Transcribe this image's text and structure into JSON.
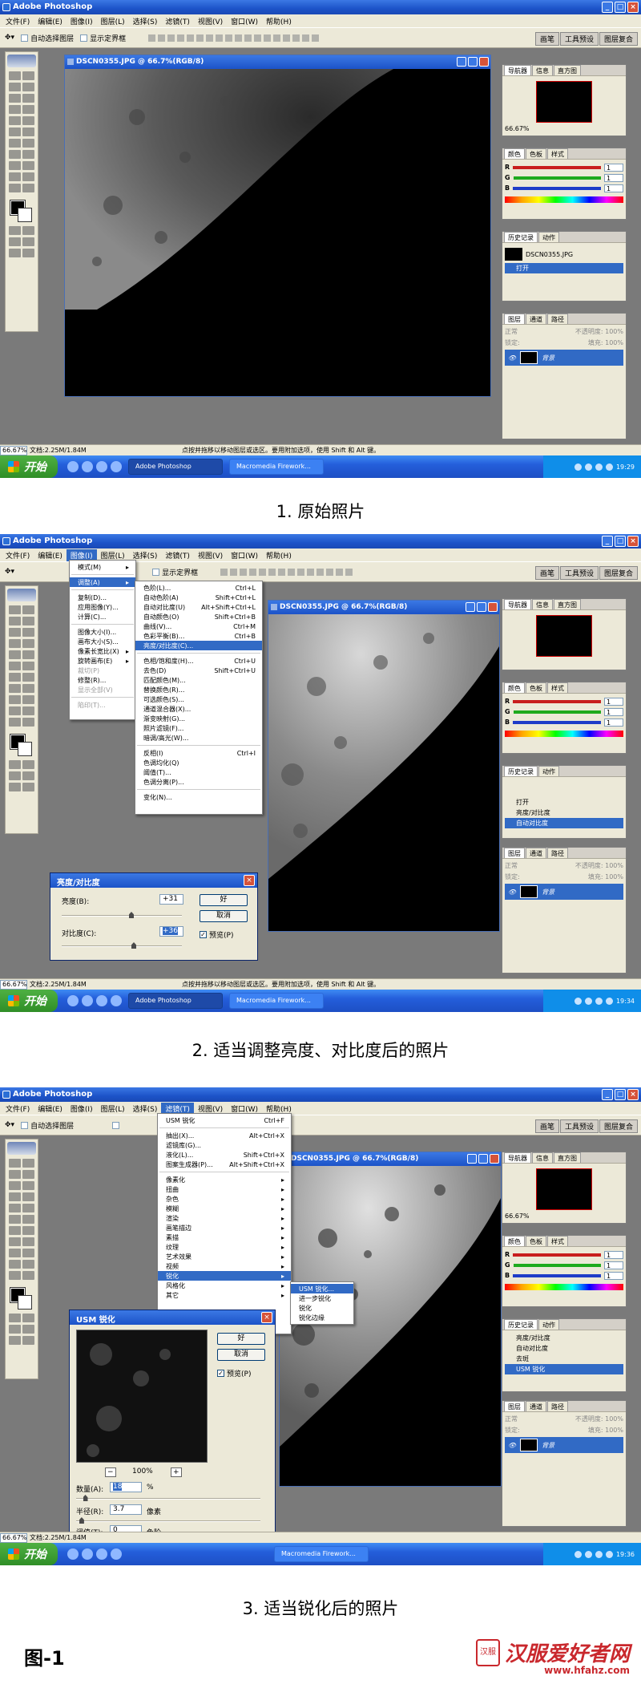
{
  "app": {
    "title": "Adobe Photoshop",
    "menus": [
      "文件(F)",
      "编辑(E)",
      "图像(I)",
      "图层(L)",
      "选择(S)",
      "滤镜(T)",
      "视图(V)",
      "窗口(W)",
      "帮助(H)"
    ],
    "opt_auto_select": "自动选择图层",
    "opt_show_bounds": "显示定界框",
    "palette_well": [
      "画笔",
      "工具预设",
      "图层复合"
    ]
  },
  "panels": {
    "navigator_tabs": [
      "导航器",
      "信息",
      "直方图"
    ],
    "navigator_zoom": "66.67%",
    "color_tabs": [
      "颜色",
      "色板",
      "样式"
    ],
    "color_rows": [
      {
        "label": "R",
        "value": "1",
        "color": "#c81e1e"
      },
      {
        "label": "G",
        "value": "1",
        "color": "#1eaa1e"
      },
      {
        "label": "B",
        "value": "1",
        "color": "#1e3cc8"
      }
    ],
    "history_tabs": [
      "历史记录",
      "动作"
    ],
    "history_doc": "DSCN0355.JPG",
    "layers_tabs": [
      "图层",
      "通道",
      "路径"
    ],
    "blend_mode": "正常",
    "opacity_label": "不透明度:",
    "opacity_value": "100%",
    "lock_label": "锁定:",
    "fill_label": "填充:",
    "fill_value": "100%",
    "layer_name": "背景"
  },
  "status": {
    "zoom": "66.67%",
    "doc_info": "文档:2.25M/1.84M",
    "tip": "点按并拖移以移动图层或选区。要用附加选项，使用 Shift 和 Alt 键。"
  },
  "taskbar": {
    "start": "开始",
    "task1": "Adobe Photoshop",
    "task2": "Macromedia Firework..."
  },
  "shots": [
    {
      "doc_title": "DSCN0355.JPG @ 66.7%(RGB/8)",
      "history": [
        "打开"
      ],
      "clock": "19:29",
      "caption": "1. 原始照片"
    },
    {
      "doc_title": "DSCN0355.JPG @ 66.7%(RGB/8)",
      "history": [
        "打开",
        "亮度/对比度",
        "自动对比度"
      ],
      "clock": "19:34",
      "caption": "2. 适当调整亮度、对比度后的照片"
    },
    {
      "doc_title": "DSCN0355.JPG @ 66.7%(RGB/8)",
      "history": [
        "亮度/对比度",
        "自动对比度",
        "去斑",
        "USM 锐化"
      ],
      "clock": "19:36",
      "caption": "3. 适当锐化后的照片"
    }
  ],
  "image_menu": {
    "items": [
      {
        "label": "模式(M)",
        "arrow": true
      },
      {
        "sep": true
      },
      {
        "label": "调整(A)",
        "arrow": true,
        "sel": true
      },
      {
        "sep": true
      },
      {
        "label": "复制(D)..."
      },
      {
        "label": "应用图像(Y)..."
      },
      {
        "label": "计算(C)..."
      },
      {
        "sep": true
      },
      {
        "label": "图像大小(I)..."
      },
      {
        "label": "画布大小(S)..."
      },
      {
        "label": "像素长宽比(X)",
        "arrow": true
      },
      {
        "label": "旋转画布(E)",
        "arrow": true
      },
      {
        "label": "裁切(P)",
        "dis": true
      },
      {
        "label": "修整(R)..."
      },
      {
        "label": "显示全部(V)",
        "dis": true
      },
      {
        "sep": true
      },
      {
        "label": "陷印(T)...",
        "dis": true
      }
    ]
  },
  "adjust_menu": {
    "items": [
      {
        "label": "色阶(L)...",
        "key": "Ctrl+L"
      },
      {
        "label": "自动色阶(A)",
        "key": "Shift+Ctrl+L"
      },
      {
        "label": "自动对比度(U)",
        "key": "Alt+Shift+Ctrl+L"
      },
      {
        "label": "自动颜色(O)",
        "key": "Shift+Ctrl+B"
      },
      {
        "label": "曲线(V)...",
        "key": "Ctrl+M"
      },
      {
        "label": "色彩平衡(B)...",
        "key": "Ctrl+B"
      },
      {
        "label": "亮度/对比度(C)...",
        "sel": true
      },
      {
        "sep": true
      },
      {
        "label": "色相/饱和度(H)...",
        "key": "Ctrl+U"
      },
      {
        "label": "去色(D)",
        "key": "Shift+Ctrl+U"
      },
      {
        "label": "匹配颜色(M)..."
      },
      {
        "label": "替换颜色(R)..."
      },
      {
        "label": "可选颜色(S)..."
      },
      {
        "label": "通道混合器(X)..."
      },
      {
        "label": "渐变映射(G)..."
      },
      {
        "label": "照片滤镜(F)..."
      },
      {
        "label": "暗调/高光(W)..."
      },
      {
        "sep": true
      },
      {
        "label": "反相(I)",
        "key": "Ctrl+I"
      },
      {
        "label": "色调均化(Q)"
      },
      {
        "label": "阈值(T)..."
      },
      {
        "label": "色调分离(P)..."
      },
      {
        "sep": true
      },
      {
        "label": "变化(N)..."
      }
    ]
  },
  "brightness_dialog": {
    "title": "亮度/对比度",
    "brightness_label": "亮度(B):",
    "brightness_value": "+31",
    "brightness_level": 0.58,
    "contrast_label": "对比度(C):",
    "contrast_value": "+36",
    "contrast_level": 0.6,
    "ok": "好",
    "cancel": "取消",
    "preview": "预览(P)"
  },
  "filter_menu": {
    "items": [
      {
        "label": "USM 锐化",
        "key": "Ctrl+F"
      },
      {
        "sep": true
      },
      {
        "label": "抽出(X)...",
        "key": "Alt+Ctrl+X"
      },
      {
        "label": "滤镜库(G)..."
      },
      {
        "label": "液化(L)...",
        "key": "Shift+Ctrl+X"
      },
      {
        "label": "图案生成器(P)...",
        "key": "Alt+Shift+Ctrl+X"
      },
      {
        "sep": true
      },
      {
        "label": "像素化",
        "arrow": true
      },
      {
        "label": "扭曲",
        "arrow": true
      },
      {
        "label": "杂色",
        "arrow": true
      },
      {
        "label": "模糊",
        "arrow": true
      },
      {
        "label": "渲染",
        "arrow": true
      },
      {
        "label": "画笔描边",
        "arrow": true
      },
      {
        "label": "素描",
        "arrow": true
      },
      {
        "label": "纹理",
        "arrow": true
      },
      {
        "label": "艺术效果",
        "arrow": true
      },
      {
        "label": "视频",
        "arrow": true
      },
      {
        "label": "锐化",
        "arrow": true,
        "sel": true
      },
      {
        "label": "风格化",
        "arrow": true
      },
      {
        "label": "其它",
        "arrow": true
      }
    ]
  },
  "sharpen_menu": {
    "items": [
      {
        "label": "USM 锐化...",
        "sel": true
      },
      {
        "label": "进一步锐化"
      },
      {
        "label": "锐化"
      },
      {
        "label": "锐化边缘"
      }
    ]
  },
  "usm_dialog": {
    "title": "USM 锐化",
    "ok": "好",
    "cancel": "取消",
    "preview": "预览(P)",
    "zoom": "100%",
    "amount_label": "数量(A):",
    "amount_value": "18",
    "amount_unit": "%",
    "amount_level": 0.05,
    "radius_label": "半径(R):",
    "radius_value": "3.7",
    "radius_unit": "像素",
    "radius_level": 0.03,
    "threshold_label": "阈值(T):",
    "threshold_value": "0",
    "threshold_unit": "色阶",
    "threshold_level": 0.0
  },
  "figure_label": "图-1",
  "logo": {
    "text": "汉服爱好者网",
    "url": "www.hfahz.com",
    "seal": "汉服"
  }
}
